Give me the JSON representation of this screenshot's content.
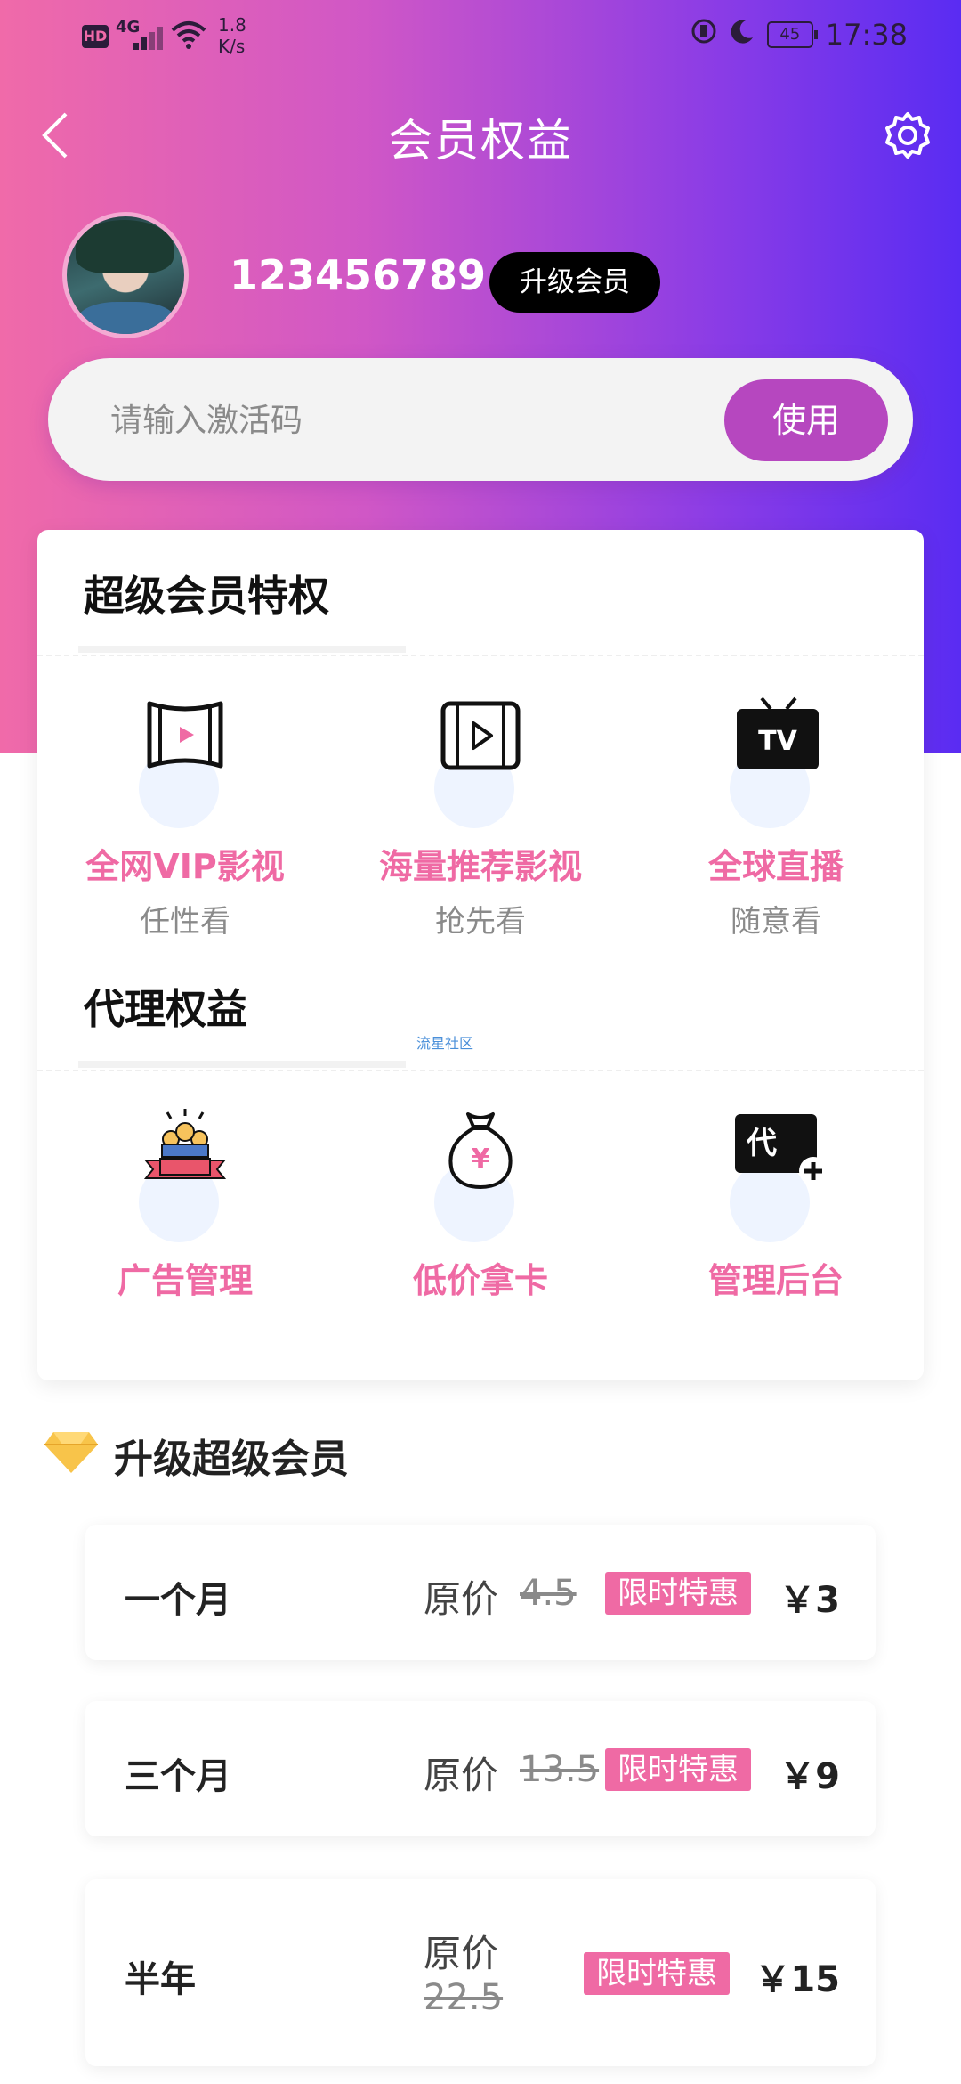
{
  "status_bar": {
    "hd": "HD",
    "network": "4G",
    "speed_value": "1.8",
    "speed_unit": "K/s",
    "battery": "45",
    "time": "17:38"
  },
  "header": {
    "title": "会员权益",
    "back_icon": "chevron-left-icon",
    "settings_icon": "gear-icon"
  },
  "profile": {
    "username": "123456789",
    "upgrade_label": "升级会员"
  },
  "activation": {
    "placeholder": "请输入激活码",
    "value": "",
    "button_label": "使用"
  },
  "super_privileges": {
    "title": "超级会员特权",
    "items": [
      {
        "icon": "film-reel-icon",
        "name": "全网VIP影视",
        "sub": "任性看"
      },
      {
        "icon": "video-play-icon",
        "name": "海量推荐影视",
        "sub": "抢先看"
      },
      {
        "icon": "tv-icon",
        "name": "全球直播",
        "sub": "随意看"
      }
    ]
  },
  "agent_rights": {
    "title": "代理权益",
    "watermark": "流星社区",
    "items": [
      {
        "icon": "podium-icon",
        "name": "广告管理"
      },
      {
        "icon": "money-bag-icon",
        "name": "低价拿卡"
      },
      {
        "icon": "agent-plus-icon",
        "name": "管理后台"
      }
    ]
  },
  "upgrade_section": {
    "title": "升级超级会员",
    "icon": "diamond-icon",
    "accent_color": "#ef6aa4",
    "plans": [
      {
        "name": "一个月",
        "orig_label": "原价",
        "orig_price": "4.5",
        "tag": "限时特惠",
        "price": "￥3"
      },
      {
        "name": "三个月",
        "orig_label": "原价",
        "orig_price": "13.5",
        "tag": "限时特惠",
        "price": "￥9"
      },
      {
        "name": "半年",
        "orig_label": "原价",
        "orig_price": "22.5",
        "tag": "限时特惠",
        "price": "￥15"
      }
    ]
  }
}
